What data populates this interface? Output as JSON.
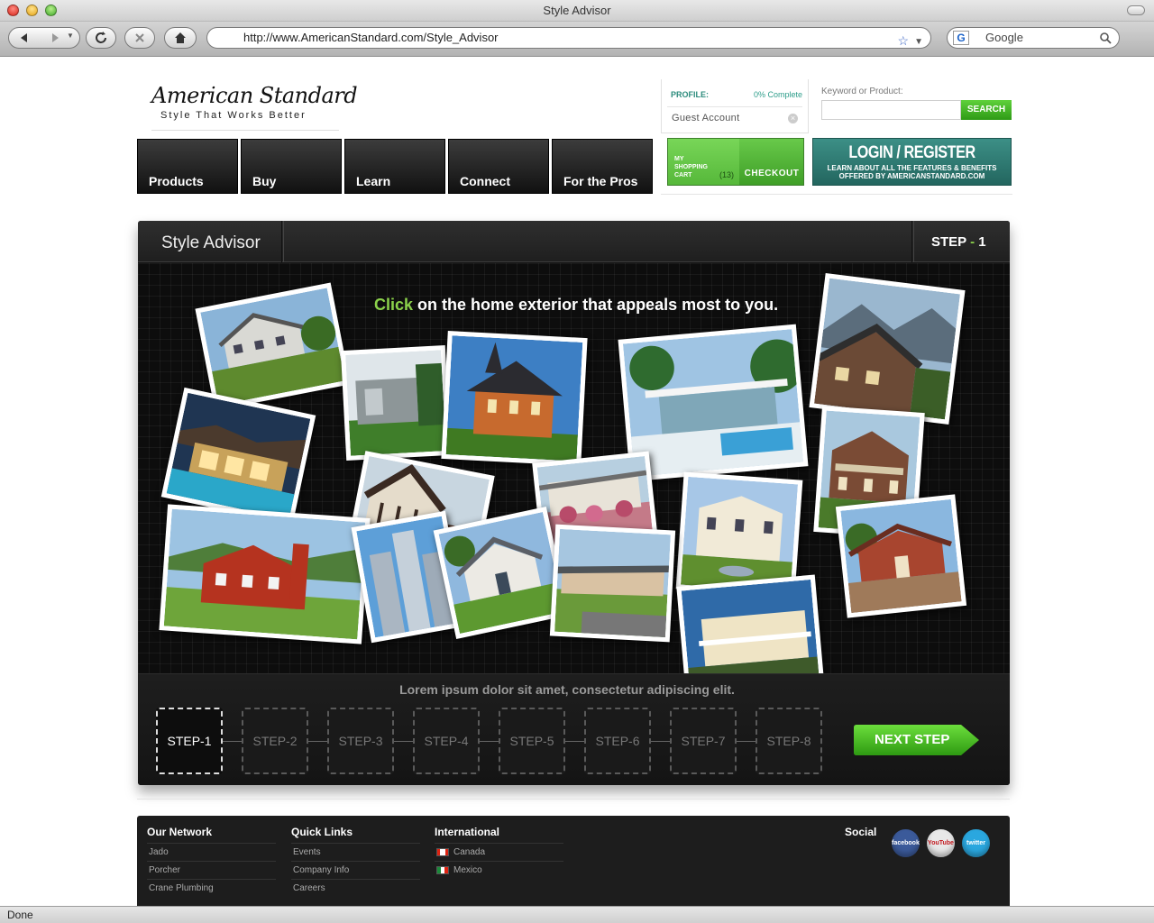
{
  "window": {
    "title": "Style Advisor"
  },
  "toolbar": {
    "url": "http://www.AmericanStandard.com/Style_Advisor",
    "search_engine_badge": "G",
    "search_placeholder": "Google"
  },
  "status": {
    "text": "Done"
  },
  "brand": {
    "name": "American Standard",
    "tagline": "Style That Works Better"
  },
  "nav": {
    "items": [
      "Products",
      "Buy",
      "Learn",
      "Connect",
      "For the Pros"
    ]
  },
  "account": {
    "profile_label": "PROFILE:",
    "profile_pct": "0% Complete",
    "guest": "Guest Account"
  },
  "search": {
    "label": "Keyword or Product:",
    "button": "SEARCH"
  },
  "cart": {
    "label_line1": "MY",
    "label_line2": "SHOPPING",
    "label_line3": "CART",
    "count": "(13)",
    "checkout": "CHECKOUT"
  },
  "login": {
    "title": "LOGIN / REGISTER",
    "sub_line1": "LEARN ABOUT ALL THE FEATURES & BENEFITS",
    "sub_line2": "OFFERED BY AMERICANSTANDARD.COM"
  },
  "advisor": {
    "title": "Style Advisor",
    "step_word": "STEP",
    "step_dash": " - ",
    "step_num": "1",
    "prompt_accent": "Click",
    "prompt_rest": " on the home exterior that appeals most to you.",
    "caption": "Lorem ipsum dolor sit amet, consectetur adipiscing elit.",
    "steps": [
      "STEP-1",
      "STEP-2",
      "STEP-3",
      "STEP-4",
      "STEP-5",
      "STEP-6",
      "STEP-7",
      "STEP-8"
    ],
    "next_button": "NEXT STEP",
    "accent_color": "#8bd14b"
  },
  "footer": {
    "network_title": "Our Network",
    "network": [
      "Jado",
      "Porcher",
      "Crane Plumbing"
    ],
    "quick_title": "Quick Links",
    "quick": [
      "Events",
      "Company Info",
      "Careers"
    ],
    "intl_title": "International",
    "intl": [
      "Canada",
      "Mexico"
    ],
    "social_title": "Social",
    "social": [
      "facebook",
      "YouTube",
      "twitter"
    ]
  }
}
